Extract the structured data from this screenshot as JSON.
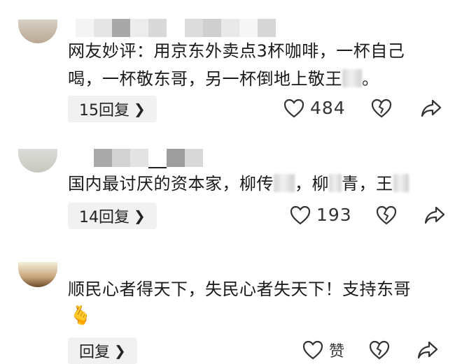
{
  "comments": [
    {
      "text_a": "网友妙评：用京东外卖点3杯咖啡，一杯自己",
      "text_b": "喝，一杯敬东哥，另一杯倒地上敬王",
      "text_c": "。",
      "reply_label": "15回复",
      "like_count": "484"
    },
    {
      "text_a": "国内最讨厌的资本家，柳传",
      "text_b": "，柳",
      "text_c": "青，王",
      "reply_label": "14回复",
      "like_count": "193"
    },
    {
      "text_a": "顺民心者得天下，失民心者失天下！支持东哥",
      "emoji": "🫰",
      "reply_label": "回复",
      "like_count": "赞"
    }
  ],
  "icons": {
    "like": "heart-outline-icon",
    "dislike": "broken-heart-icon",
    "share": "share-arrow-icon",
    "reply_chevron": "chevron-right-icon"
  }
}
